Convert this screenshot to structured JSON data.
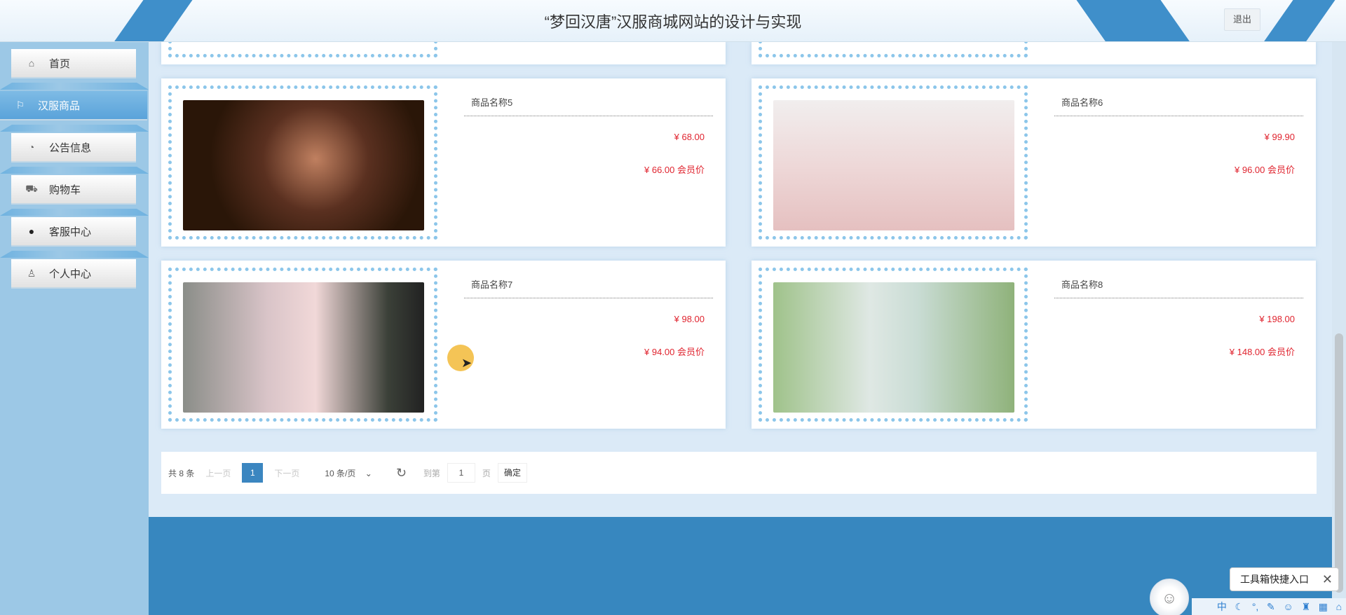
{
  "header": {
    "title": "“梦回汉唐”汉服商城网站的设计与实现",
    "logout_label": "退出"
  },
  "sidebar": {
    "items": [
      {
        "label": "首页",
        "icon": "home-icon",
        "glyph": "⌂"
      },
      {
        "label": "汉服商品",
        "icon": "flag-icon",
        "glyph": "⚐"
      },
      {
        "label": "公告信息",
        "icon": "gauge-icon",
        "glyph": "◔"
      },
      {
        "label": "购物车",
        "icon": "cart-icon",
        "glyph": "🛒"
      },
      {
        "label": "客服中心",
        "icon": "chat-icon",
        "glyph": "●"
      },
      {
        "label": "个人中心",
        "icon": "user-icon",
        "glyph": "♙"
      }
    ],
    "active_index": 1
  },
  "products": [
    {
      "name": "商品名称5",
      "price": "¥ 68.00",
      "member_price": "¥ 66.00 会员价"
    },
    {
      "name": "商品名称6",
      "price": "¥ 99.90",
      "member_price": "¥ 96.00 会员价"
    },
    {
      "name": "商品名称7",
      "price": "¥ 98.00",
      "member_price": "¥ 94.00 会员价"
    },
    {
      "name": "商品名称8",
      "price": "¥ 198.00",
      "member_price": "¥ 148.00 会员价"
    }
  ],
  "pagination": {
    "total": "共 8 条",
    "prev": "上一页",
    "current": "1",
    "next": "下一页",
    "page_size": "10 条/页",
    "goto": "到第",
    "goto_value": "1",
    "page_unit": "页",
    "confirm": "确定"
  },
  "toolbox": {
    "label": "工具箱快捷入口",
    "close": "✕"
  },
  "ime": {
    "lang": "中"
  },
  "colors": {
    "accent": "#3b86c0",
    "price": "#e0242f",
    "footer": "#3787bf"
  }
}
